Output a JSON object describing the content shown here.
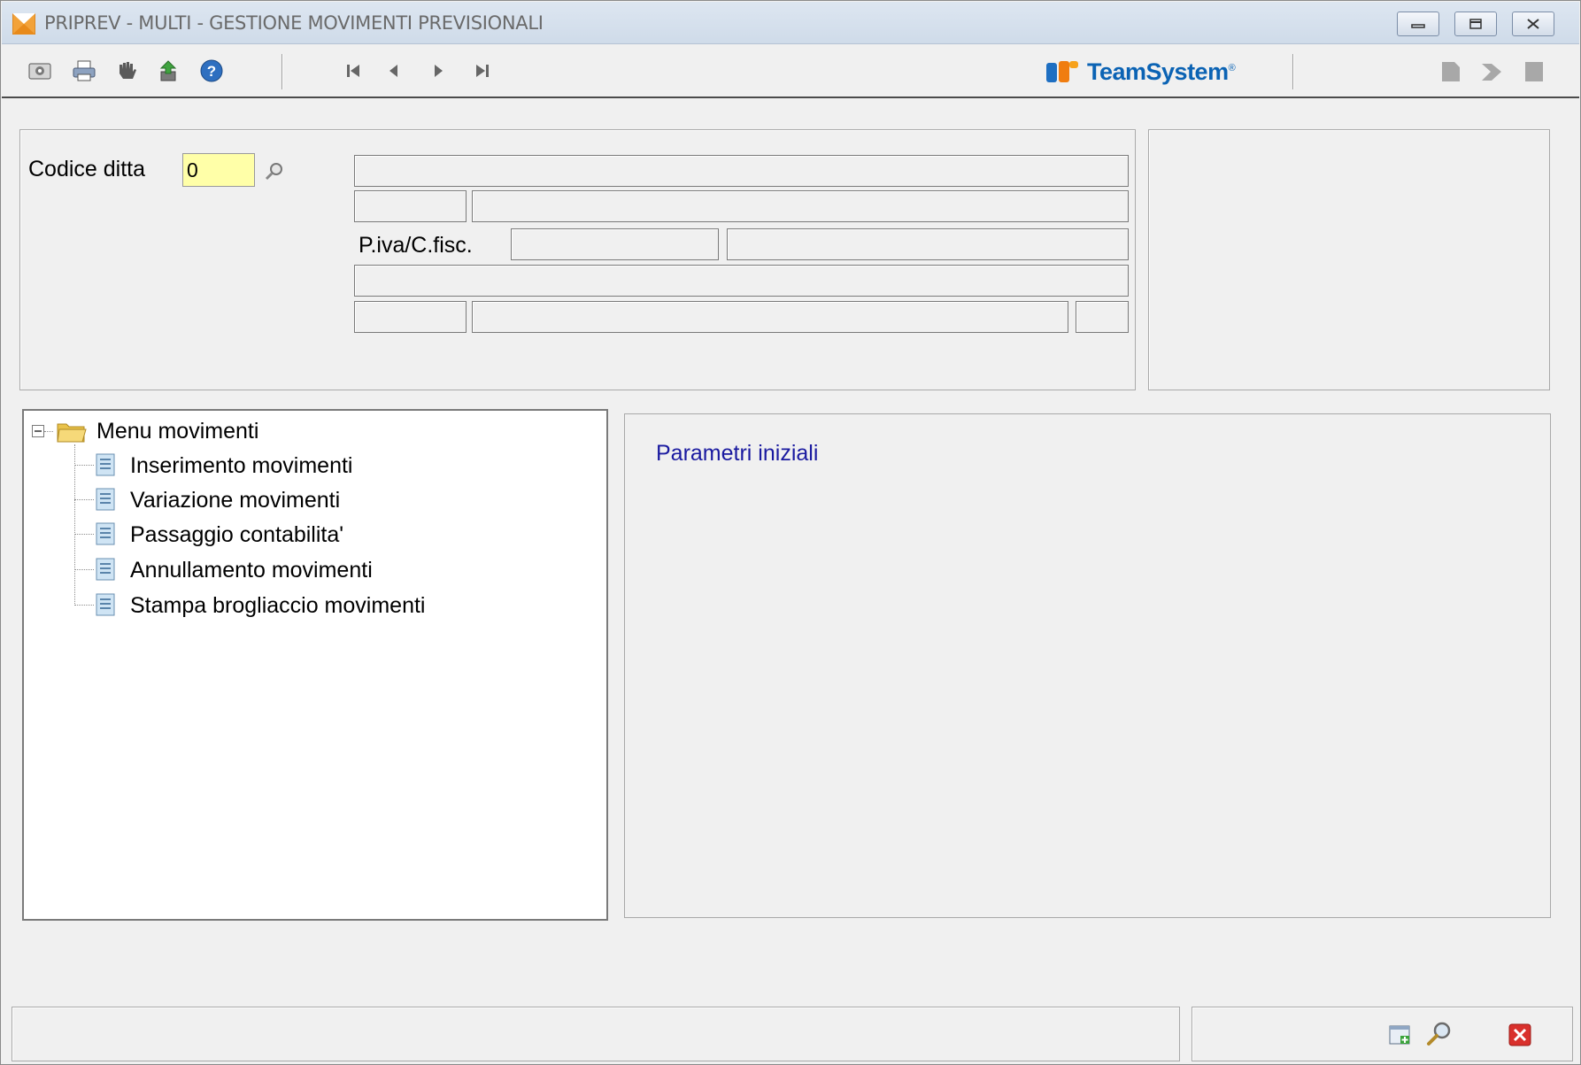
{
  "window": {
    "title": "PRIPREV  - MULTI -  GESTIONE MOVIMENTI PREVISIONALI",
    "controls": [
      "minimize",
      "restore",
      "close"
    ]
  },
  "toolbar": {
    "left_icons": [
      "preview-icon",
      "print-icon",
      "hand-icon",
      "export-icon",
      "help-icon"
    ],
    "nav_icons": [
      "first-record-icon",
      "previous-record-icon",
      "next-record-icon",
      "last-record-icon"
    ],
    "brand": "TeamSystem",
    "brand_mark": "®",
    "right_icons": [
      "page-icon",
      "forward-icon",
      "document-icon"
    ]
  },
  "company": {
    "code_label": "Codice ditta",
    "code_value": "0",
    "vat_label": "P.iva/C.fisc."
  },
  "tree": {
    "root_label": "Menu movimenti",
    "items": [
      {
        "label": "Inserimento movimenti"
      },
      {
        "label": "Variazione movimenti"
      },
      {
        "label": "Passaggio contabilita'"
      },
      {
        "label": "Annullamento movimenti"
      },
      {
        "label": "Stampa brogliaccio movimenti"
      }
    ]
  },
  "content": {
    "title": "Parametri iniziali"
  },
  "status": {
    "icons": [
      "new-document-icon",
      "search-icon",
      "close-icon"
    ]
  },
  "colors": {
    "input_bg": "#ffffa8",
    "content_title": "#1a1aa0",
    "brand": "#0b63b4",
    "close_red": "#d9302c"
  }
}
